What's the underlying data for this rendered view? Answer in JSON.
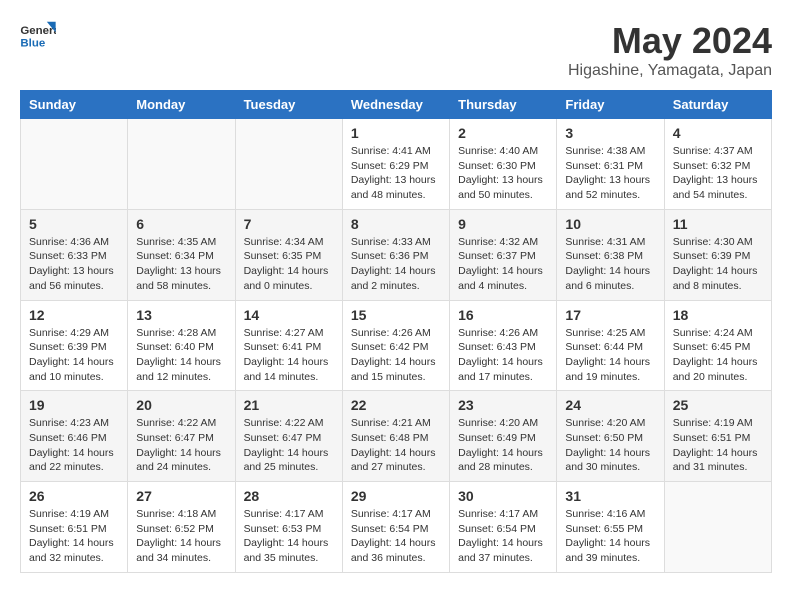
{
  "logo": {
    "line1": "General",
    "line2": "Blue"
  },
  "title": "May 2024",
  "location": "Higashine, Yamagata, Japan",
  "weekdays": [
    "Sunday",
    "Monday",
    "Tuesday",
    "Wednesday",
    "Thursday",
    "Friday",
    "Saturday"
  ],
  "weeks": [
    [
      {
        "day": "",
        "info": ""
      },
      {
        "day": "",
        "info": ""
      },
      {
        "day": "",
        "info": ""
      },
      {
        "day": "1",
        "info": "Sunrise: 4:41 AM\nSunset: 6:29 PM\nDaylight: 13 hours\nand 48 minutes."
      },
      {
        "day": "2",
        "info": "Sunrise: 4:40 AM\nSunset: 6:30 PM\nDaylight: 13 hours\nand 50 minutes."
      },
      {
        "day": "3",
        "info": "Sunrise: 4:38 AM\nSunset: 6:31 PM\nDaylight: 13 hours\nand 52 minutes."
      },
      {
        "day": "4",
        "info": "Sunrise: 4:37 AM\nSunset: 6:32 PM\nDaylight: 13 hours\nand 54 minutes."
      }
    ],
    [
      {
        "day": "5",
        "info": "Sunrise: 4:36 AM\nSunset: 6:33 PM\nDaylight: 13 hours\nand 56 minutes."
      },
      {
        "day": "6",
        "info": "Sunrise: 4:35 AM\nSunset: 6:34 PM\nDaylight: 13 hours\nand 58 minutes."
      },
      {
        "day": "7",
        "info": "Sunrise: 4:34 AM\nSunset: 6:35 PM\nDaylight: 14 hours\nand 0 minutes."
      },
      {
        "day": "8",
        "info": "Sunrise: 4:33 AM\nSunset: 6:36 PM\nDaylight: 14 hours\nand 2 minutes."
      },
      {
        "day": "9",
        "info": "Sunrise: 4:32 AM\nSunset: 6:37 PM\nDaylight: 14 hours\nand 4 minutes."
      },
      {
        "day": "10",
        "info": "Sunrise: 4:31 AM\nSunset: 6:38 PM\nDaylight: 14 hours\nand 6 minutes."
      },
      {
        "day": "11",
        "info": "Sunrise: 4:30 AM\nSunset: 6:39 PM\nDaylight: 14 hours\nand 8 minutes."
      }
    ],
    [
      {
        "day": "12",
        "info": "Sunrise: 4:29 AM\nSunset: 6:39 PM\nDaylight: 14 hours\nand 10 minutes."
      },
      {
        "day": "13",
        "info": "Sunrise: 4:28 AM\nSunset: 6:40 PM\nDaylight: 14 hours\nand 12 minutes."
      },
      {
        "day": "14",
        "info": "Sunrise: 4:27 AM\nSunset: 6:41 PM\nDaylight: 14 hours\nand 14 minutes."
      },
      {
        "day": "15",
        "info": "Sunrise: 4:26 AM\nSunset: 6:42 PM\nDaylight: 14 hours\nand 15 minutes."
      },
      {
        "day": "16",
        "info": "Sunrise: 4:26 AM\nSunset: 6:43 PM\nDaylight: 14 hours\nand 17 minutes."
      },
      {
        "day": "17",
        "info": "Sunrise: 4:25 AM\nSunset: 6:44 PM\nDaylight: 14 hours\nand 19 minutes."
      },
      {
        "day": "18",
        "info": "Sunrise: 4:24 AM\nSunset: 6:45 PM\nDaylight: 14 hours\nand 20 minutes."
      }
    ],
    [
      {
        "day": "19",
        "info": "Sunrise: 4:23 AM\nSunset: 6:46 PM\nDaylight: 14 hours\nand 22 minutes."
      },
      {
        "day": "20",
        "info": "Sunrise: 4:22 AM\nSunset: 6:47 PM\nDaylight: 14 hours\nand 24 minutes."
      },
      {
        "day": "21",
        "info": "Sunrise: 4:22 AM\nSunset: 6:47 PM\nDaylight: 14 hours\nand 25 minutes."
      },
      {
        "day": "22",
        "info": "Sunrise: 4:21 AM\nSunset: 6:48 PM\nDaylight: 14 hours\nand 27 minutes."
      },
      {
        "day": "23",
        "info": "Sunrise: 4:20 AM\nSunset: 6:49 PM\nDaylight: 14 hours\nand 28 minutes."
      },
      {
        "day": "24",
        "info": "Sunrise: 4:20 AM\nSunset: 6:50 PM\nDaylight: 14 hours\nand 30 minutes."
      },
      {
        "day": "25",
        "info": "Sunrise: 4:19 AM\nSunset: 6:51 PM\nDaylight: 14 hours\nand 31 minutes."
      }
    ],
    [
      {
        "day": "26",
        "info": "Sunrise: 4:19 AM\nSunset: 6:51 PM\nDaylight: 14 hours\nand 32 minutes."
      },
      {
        "day": "27",
        "info": "Sunrise: 4:18 AM\nSunset: 6:52 PM\nDaylight: 14 hours\nand 34 minutes."
      },
      {
        "day": "28",
        "info": "Sunrise: 4:17 AM\nSunset: 6:53 PM\nDaylight: 14 hours\nand 35 minutes."
      },
      {
        "day": "29",
        "info": "Sunrise: 4:17 AM\nSunset: 6:54 PM\nDaylight: 14 hours\nand 36 minutes."
      },
      {
        "day": "30",
        "info": "Sunrise: 4:17 AM\nSunset: 6:54 PM\nDaylight: 14 hours\nand 37 minutes."
      },
      {
        "day": "31",
        "info": "Sunrise: 4:16 AM\nSunset: 6:55 PM\nDaylight: 14 hours\nand 39 minutes."
      },
      {
        "day": "",
        "info": ""
      }
    ]
  ]
}
